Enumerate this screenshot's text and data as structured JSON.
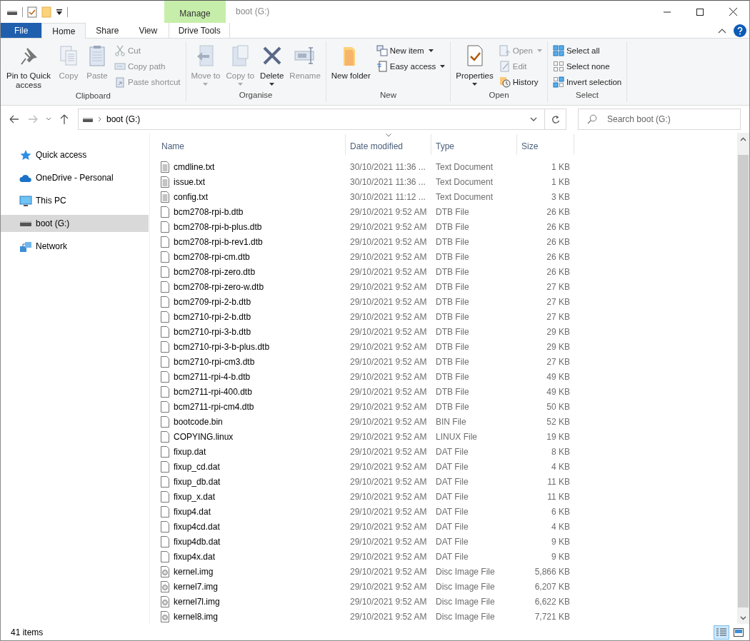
{
  "window": {
    "title": "boot (G:)",
    "context_label": "Manage"
  },
  "tabs": [
    {
      "label": "File",
      "kind": "file",
      "selected": false
    },
    {
      "label": "Home",
      "kind": "normal",
      "selected": true
    },
    {
      "label": "Share",
      "kind": "normal",
      "selected": false
    },
    {
      "label": "View",
      "kind": "normal",
      "selected": false
    },
    {
      "label": "Drive Tools",
      "kind": "context",
      "selected": false
    }
  ],
  "ribbon": [
    {
      "label": "Clipboard",
      "items": [
        {
          "kind": "large",
          "label": "Pin to Quick access",
          "disabled": false,
          "menu": false
        },
        {
          "kind": "large",
          "label": "Copy",
          "disabled": true,
          "menu": false
        },
        {
          "kind": "large",
          "label": "Paste",
          "disabled": true,
          "menu": false
        },
        {
          "kind": "small",
          "label": "Cut",
          "disabled": true,
          "menu": false
        },
        {
          "kind": "small",
          "label": "Copy path",
          "disabled": true,
          "menu": false
        },
        {
          "kind": "small",
          "label": "Paste shortcut",
          "disabled": true,
          "menu": false
        }
      ]
    },
    {
      "label": "Organise",
      "items": [
        {
          "kind": "large",
          "label": "Move to",
          "disabled": true,
          "menu": true
        },
        {
          "kind": "large",
          "label": "Copy to",
          "disabled": true,
          "menu": true
        },
        {
          "kind": "large",
          "label": "Delete",
          "disabled": false,
          "menu": true
        },
        {
          "kind": "large",
          "label": "Rename",
          "disabled": true,
          "menu": false
        }
      ]
    },
    {
      "label": "New",
      "items": [
        {
          "kind": "large",
          "label": "New folder",
          "disabled": false,
          "menu": false
        },
        {
          "kind": "small",
          "label": "New item",
          "disabled": false,
          "menu": true
        },
        {
          "kind": "small",
          "label": "Easy access",
          "disabled": false,
          "menu": true
        }
      ]
    },
    {
      "label": "Open",
      "items": [
        {
          "kind": "large",
          "label": "Properties",
          "disabled": false,
          "menu": true
        },
        {
          "kind": "small",
          "label": "Open",
          "disabled": true,
          "menu": true
        },
        {
          "kind": "small",
          "label": "Edit",
          "disabled": true,
          "menu": false
        },
        {
          "kind": "small",
          "label": "History",
          "disabled": false,
          "menu": false
        }
      ]
    },
    {
      "label": "Select",
      "items": [
        {
          "kind": "small",
          "label": "Select all",
          "disabled": false,
          "menu": false
        },
        {
          "kind": "small",
          "label": "Select none",
          "disabled": false,
          "menu": false
        },
        {
          "kind": "small",
          "label": "Invert selection",
          "disabled": false,
          "menu": false
        }
      ]
    }
  ],
  "address": {
    "path": "boot (G:)"
  },
  "search": {
    "placeholder": "Search boot (G:)"
  },
  "sidebar": {
    "items": [
      {
        "label": "Quick access",
        "kind": "star",
        "selected": false
      },
      {
        "label": "OneDrive - Personal",
        "kind": "cloud",
        "selected": false
      },
      {
        "label": "This PC",
        "kind": "pc",
        "selected": false
      },
      {
        "label": "boot (G:)",
        "kind": "drive",
        "selected": true
      },
      {
        "label": "Network",
        "kind": "network",
        "selected": false
      }
    ]
  },
  "table": {
    "columns": [
      {
        "label": "Name",
        "sorted": false
      },
      {
        "label": "Date modified",
        "sorted": true
      },
      {
        "label": "Type",
        "sorted": false
      },
      {
        "label": "Size",
        "sorted": false
      }
    ],
    "rows": [
      {
        "kind": "text",
        "cells": [
          "cmdline.txt",
          "30/10/2021 11:36 ...",
          "Text Document",
          "1 KB"
        ]
      },
      {
        "kind": "text",
        "cells": [
          "issue.txt",
          "30/10/2021 11:36 ...",
          "Text Document",
          "1 KB"
        ]
      },
      {
        "kind": "text",
        "cells": [
          "config.txt",
          "30/10/2021 11:12 ...",
          "Text Document",
          "3 KB"
        ]
      },
      {
        "kind": "blank",
        "cells": [
          "bcm2708-rpi-b.dtb",
          "29/10/2021 9:52 AM",
          "DTB File",
          "26 KB"
        ]
      },
      {
        "kind": "blank",
        "cells": [
          "bcm2708-rpi-b-plus.dtb",
          "29/10/2021 9:52 AM",
          "DTB File",
          "26 KB"
        ]
      },
      {
        "kind": "blank",
        "cells": [
          "bcm2708-rpi-b-rev1.dtb",
          "29/10/2021 9:52 AM",
          "DTB File",
          "26 KB"
        ]
      },
      {
        "kind": "blank",
        "cells": [
          "bcm2708-rpi-cm.dtb",
          "29/10/2021 9:52 AM",
          "DTB File",
          "26 KB"
        ]
      },
      {
        "kind": "blank",
        "cells": [
          "bcm2708-rpi-zero.dtb",
          "29/10/2021 9:52 AM",
          "DTB File",
          "26 KB"
        ]
      },
      {
        "kind": "blank",
        "cells": [
          "bcm2708-rpi-zero-w.dtb",
          "29/10/2021 9:52 AM",
          "DTB File",
          "27 KB"
        ]
      },
      {
        "kind": "blank",
        "cells": [
          "bcm2709-rpi-2-b.dtb",
          "29/10/2021 9:52 AM",
          "DTB File",
          "27 KB"
        ]
      },
      {
        "kind": "blank",
        "cells": [
          "bcm2710-rpi-2-b.dtb",
          "29/10/2021 9:52 AM",
          "DTB File",
          "27 KB"
        ]
      },
      {
        "kind": "blank",
        "cells": [
          "bcm2710-rpi-3-b.dtb",
          "29/10/2021 9:52 AM",
          "DTB File",
          "29 KB"
        ]
      },
      {
        "kind": "blank",
        "cells": [
          "bcm2710-rpi-3-b-plus.dtb",
          "29/10/2021 9:52 AM",
          "DTB File",
          "29 KB"
        ]
      },
      {
        "kind": "blank",
        "cells": [
          "bcm2710-rpi-cm3.dtb",
          "29/10/2021 9:52 AM",
          "DTB File",
          "27 KB"
        ]
      },
      {
        "kind": "blank",
        "cells": [
          "bcm2711-rpi-4-b.dtb",
          "29/10/2021 9:52 AM",
          "DTB File",
          "49 KB"
        ]
      },
      {
        "kind": "blank",
        "cells": [
          "bcm2711-rpi-400.dtb",
          "29/10/2021 9:52 AM",
          "DTB File",
          "49 KB"
        ]
      },
      {
        "kind": "blank",
        "cells": [
          "bcm2711-rpi-cm4.dtb",
          "29/10/2021 9:52 AM",
          "DTB File",
          "50 KB"
        ]
      },
      {
        "kind": "blank",
        "cells": [
          "bootcode.bin",
          "29/10/2021 9:52 AM",
          "BIN File",
          "52 KB"
        ]
      },
      {
        "kind": "blank",
        "cells": [
          "COPYING.linux",
          "29/10/2021 9:52 AM",
          "LINUX File",
          "19 KB"
        ]
      },
      {
        "kind": "blank",
        "cells": [
          "fixup.dat",
          "29/10/2021 9:52 AM",
          "DAT File",
          "8 KB"
        ]
      },
      {
        "kind": "blank",
        "cells": [
          "fixup_cd.dat",
          "29/10/2021 9:52 AM",
          "DAT File",
          "4 KB"
        ]
      },
      {
        "kind": "blank",
        "cells": [
          "fixup_db.dat",
          "29/10/2021 9:52 AM",
          "DAT File",
          "11 KB"
        ]
      },
      {
        "kind": "blank",
        "cells": [
          "fixup_x.dat",
          "29/10/2021 9:52 AM",
          "DAT File",
          "11 KB"
        ]
      },
      {
        "kind": "blank",
        "cells": [
          "fixup4.dat",
          "29/10/2021 9:52 AM",
          "DAT File",
          "6 KB"
        ]
      },
      {
        "kind": "blank",
        "cells": [
          "fixup4cd.dat",
          "29/10/2021 9:52 AM",
          "DAT File",
          "4 KB"
        ]
      },
      {
        "kind": "blank",
        "cells": [
          "fixup4db.dat",
          "29/10/2021 9:52 AM",
          "DAT File",
          "9 KB"
        ]
      },
      {
        "kind": "blank",
        "cells": [
          "fixup4x.dat",
          "29/10/2021 9:52 AM",
          "DAT File",
          "9 KB"
        ]
      },
      {
        "kind": "disc",
        "cells": [
          "kernel.img",
          "29/10/2021 9:52 AM",
          "Disc Image File",
          "5,866 KB"
        ]
      },
      {
        "kind": "disc",
        "cells": [
          "kernel7.img",
          "29/10/2021 9:52 AM",
          "Disc Image File",
          "6,207 KB"
        ]
      },
      {
        "kind": "disc",
        "cells": [
          "kernel7l.img",
          "29/10/2021 9:52 AM",
          "Disc Image File",
          "6,622 KB"
        ]
      },
      {
        "kind": "disc",
        "cells": [
          "kernel8.img",
          "29/10/2021 9:52 AM",
          "Disc Image File",
          "7,721 KB"
        ]
      }
    ]
  },
  "status_bar": {
    "count": "41 items",
    "views": [
      {
        "kind": "details",
        "selected": true
      },
      {
        "kind": "large",
        "selected": false
      }
    ]
  }
}
